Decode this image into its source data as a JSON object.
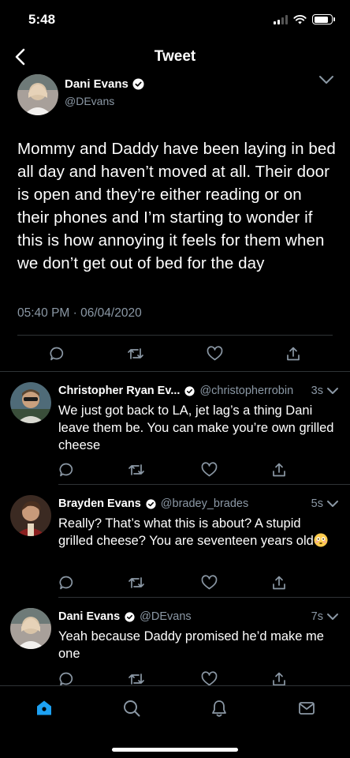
{
  "status_bar": {
    "time": "5:48",
    "battery_level": 0.85
  },
  "header": {
    "title": "Tweet"
  },
  "main_tweet": {
    "name": "Dani Evans",
    "handle": "@DEvans",
    "text": "Mommy and Daddy have been laying in bed all day and haven’t moved at all. Their door is open and they’re either reading or on their phones and I’m starting to wonder if this is how annoying it feels for them when we don’t get out of bed for the day",
    "timestamp": "05:40 PM · 06/04/2020"
  },
  "replies": [
    {
      "name": "Christopher Ryan Ev...",
      "handle": "@christopherrobin",
      "age": "3s",
      "text": "We just got back to LA, jet lag’s a thing Dani leave them be. You can make you’re own grilled cheese"
    },
    {
      "name": "Brayden Evans",
      "handle": "@bradey_brades",
      "age": "5s",
      "text": "Really? That’s what this is about? A stupid grilled cheese? You are seventeen years old",
      "emoji": "flushed-face-emoji"
    },
    {
      "name": "Dani Evans",
      "handle": "@DEvans",
      "age": "7s",
      "text": "Yeah because Daddy promised he’d make me one"
    }
  ],
  "icons": {
    "reply": "reply-icon",
    "retweet": "retweet-icon",
    "like": "heart-icon",
    "share": "share-icon",
    "home": "home-icon",
    "search": "search-icon",
    "notifications": "bell-icon",
    "messages": "mail-icon"
  },
  "colors": {
    "accent": "#1da1f2",
    "secondary_text": "#8b98a5",
    "divider": "#2f3336",
    "background": "#000000"
  }
}
